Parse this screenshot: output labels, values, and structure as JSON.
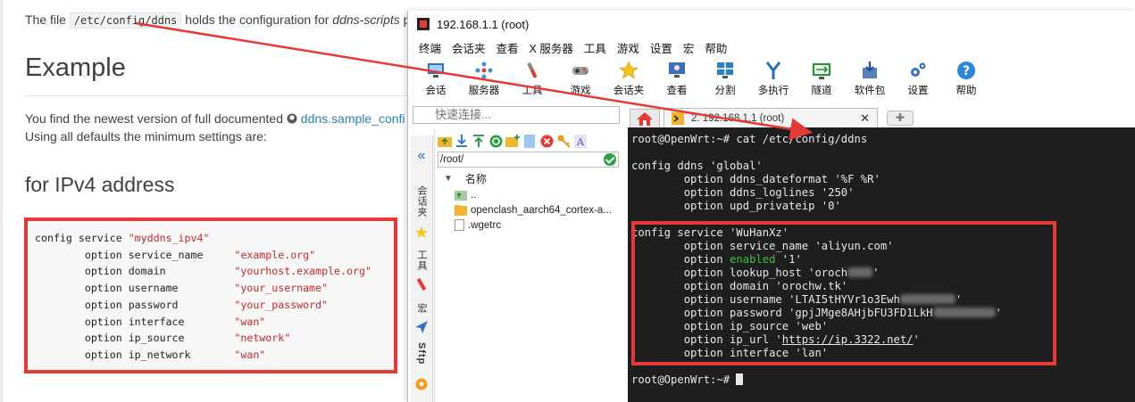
{
  "doc": {
    "intro_pre": "The file",
    "intro_code": "/etc/config/ddns",
    "intro_post": "holds the configuration for",
    "intro_em": "ddns-scripts",
    "intro_tail": "pa",
    "heading": "Example",
    "p1_text": "You find the newest version of full documented",
    "p1_link": "ddns.sample_confi",
    "p2_text": "Using all defaults the minimum settings are:",
    "subheading": "for IPv4 address",
    "code": [
      {
        "k": "config service ",
        "v": "\"myddns_ipv4\""
      },
      {
        "k": "        option service_name     ",
        "v": "\"example.org\""
      },
      {
        "k": "        option domain           ",
        "v": "\"yourhost.example.org\""
      },
      {
        "k": "        option username         ",
        "v": "\"your_username\""
      },
      {
        "k": "        option password         ",
        "v": "\"your_password\""
      },
      {
        "k": "        option interface        ",
        "v": "\"wan\""
      },
      {
        "k": "        option ip_source        ",
        "v": "\"network\""
      },
      {
        "k": "        option ip_network       ",
        "v": "\"wan\""
      }
    ]
  },
  "window": {
    "title": "192.168.1.1 (root)",
    "menu": [
      "终端",
      "会话夹",
      "查看",
      "X 服务器",
      "工具",
      "游戏",
      "设置",
      "宏",
      "帮助"
    ],
    "toolbar": [
      {
        "label": "会话",
        "icon": "monitor-session-icon"
      },
      {
        "label": "服务器",
        "icon": "servers-icon"
      },
      {
        "label": "工具",
        "icon": "tools-icon"
      },
      {
        "label": "游戏",
        "icon": "gamepad-icon"
      },
      {
        "label": "会话夹",
        "icon": "star-icon"
      },
      {
        "label": "查看",
        "icon": "view-monitor-icon"
      },
      {
        "label": "分割",
        "icon": "split-icon"
      },
      {
        "label": "多执行",
        "icon": "multiexec-icon"
      },
      {
        "label": "隧道",
        "icon": "tunnel-icon"
      },
      {
        "label": "软件包",
        "icon": "package-icon"
      },
      {
        "label": "设置",
        "icon": "gears-icon"
      },
      {
        "label": "帮助",
        "icon": "help-icon"
      }
    ],
    "quick_connect_placeholder": "快速连接...",
    "sidebar": {
      "sessions": "会话夹",
      "tools": "工具",
      "macros": "宏",
      "sftp": "Sftp"
    },
    "sftp": {
      "path": "/root/",
      "col_name": "名称",
      "files": [
        {
          "name": "..",
          "type": "up"
        },
        {
          "name": "openclash_aarch64_cortex-a...",
          "type": "folder"
        },
        {
          "name": ".wgetrc",
          "type": "file"
        }
      ]
    },
    "tab_label": "2. 192.168.1.1 (root)",
    "terminal": {
      "prompt": "root@OpenWrt:~#",
      "command": "cat /etc/config/ddns",
      "global_header": "config ddns 'global'",
      "global_opts": [
        "        option ddns_dateformat '%F %R'",
        "        option ddns_loglines '250'",
        "        option upd_privateip '0'"
      ],
      "svc_header": "config service 'WuHanXz'",
      "svc_service_name": "        option service_name 'aliyun.com'",
      "svc_enabled_key": "        option ",
      "svc_enabled_word": "enabled",
      "svc_enabled_val": " '1'",
      "svc_lookup": "        option lookup_host 'oroch",
      "svc_lookup_end": "'",
      "svc_domain": "        option domain 'orochw.tk'",
      "svc_username": "        option username 'LTAI5tHYVr1o3Ewh",
      "svc_username_end": "'",
      "svc_password": "        option password 'gpjJMge8AHjbFU3FD1LkH",
      "svc_password_end": "'",
      "svc_ipsource": "        option ip_source 'web'",
      "svc_ipurl_pre": "        option ip_url '",
      "svc_ipurl_link": "https://ip.3322.net/",
      "svc_ipurl_post": "'",
      "svc_interface": "        option interface 'lan'"
    }
  },
  "colors": {
    "highlight": "#e53935",
    "link": "#2980b9",
    "terminal_bg": "#1e1e1e",
    "enabled_green": "#3ec13e"
  }
}
